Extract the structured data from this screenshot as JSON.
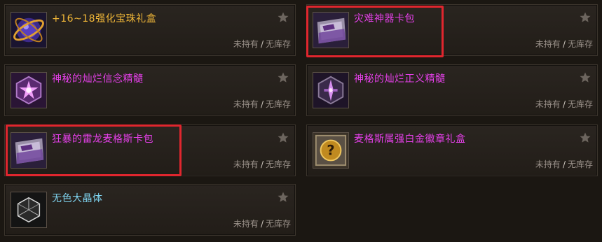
{
  "colors": {
    "gold": "#f2b838",
    "magenta": "#e640ea",
    "cyan": "#7fd4f0",
    "status_gray": "#9a918a",
    "highlight_red": "#e0262e"
  },
  "items": [
    {
      "name": "+16~18强化宝珠礼盒",
      "owned": "未持有",
      "separator": "/",
      "stock": "无库存",
      "icon": "orb-box-icon"
    },
    {
      "name": "灾难神器卡包",
      "owned": "未持有",
      "separator": "/",
      "stock": "无库存",
      "icon": "card-pack-icon"
    },
    {
      "name": "神秘的灿烂信念精髓",
      "owned": "未持有",
      "separator": "/",
      "stock": "无库存",
      "icon": "essence-star-icon"
    },
    {
      "name": "神秘的灿烂正义精髓",
      "owned": "未持有",
      "separator": "/",
      "stock": "无库存",
      "icon": "essence-sword-icon"
    },
    {
      "name": "狂暴的雷龙麦格斯卡包",
      "owned": "未持有",
      "separator": "/",
      "stock": "无库存",
      "icon": "card-pack-icon"
    },
    {
      "name": "麦格斯属强白金徽章礼盒",
      "owned": "未持有",
      "separator": "/",
      "stock": "无库存",
      "icon": "mystery-box-icon"
    },
    {
      "name": "无色大晶体",
      "owned": "未持有",
      "separator": "/",
      "stock": "无库存",
      "icon": "crystal-cube-icon"
    }
  ]
}
